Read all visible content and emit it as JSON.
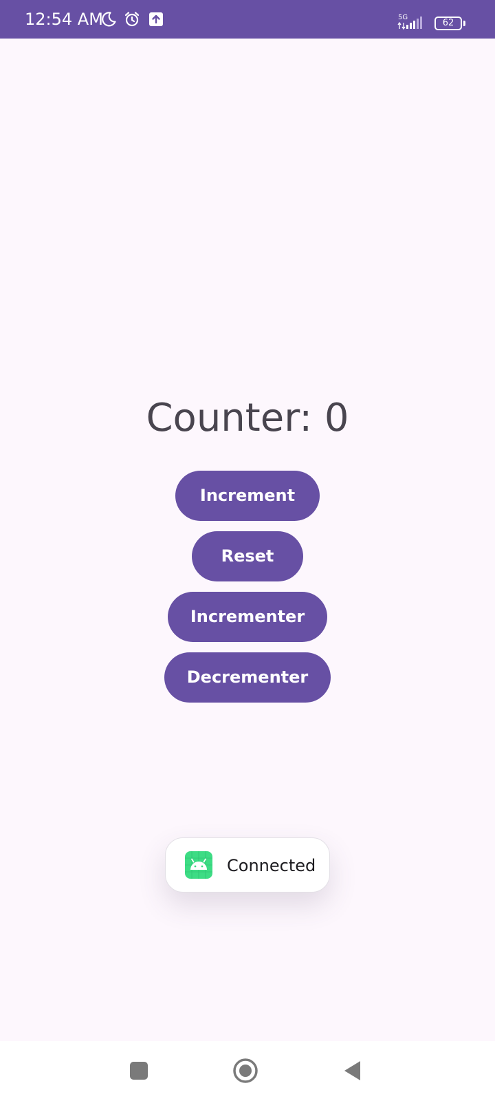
{
  "status_bar": {
    "time": "12:54 AM",
    "network": "5G",
    "battery": "62",
    "icons": [
      "moon-icon",
      "alarm-icon",
      "upload-icon",
      "signal-icon",
      "battery-icon"
    ]
  },
  "main": {
    "counter_text": "Counter: 0",
    "buttons": {
      "increment": "Increment",
      "reset": "Reset",
      "incrementer": "Incrementer",
      "decrementer": "Decrementer"
    }
  },
  "toast": {
    "icon": "android-app-icon",
    "text": "Connected"
  },
  "nav_bar": {
    "buttons": [
      "recents-button",
      "home-button",
      "back-button"
    ]
  },
  "colors": {
    "primary": "#6750a4",
    "background": "#fdf7fd",
    "counter_text": "#49454f",
    "toast_background": "#ffffff",
    "android_icon": "#3ddc84"
  }
}
